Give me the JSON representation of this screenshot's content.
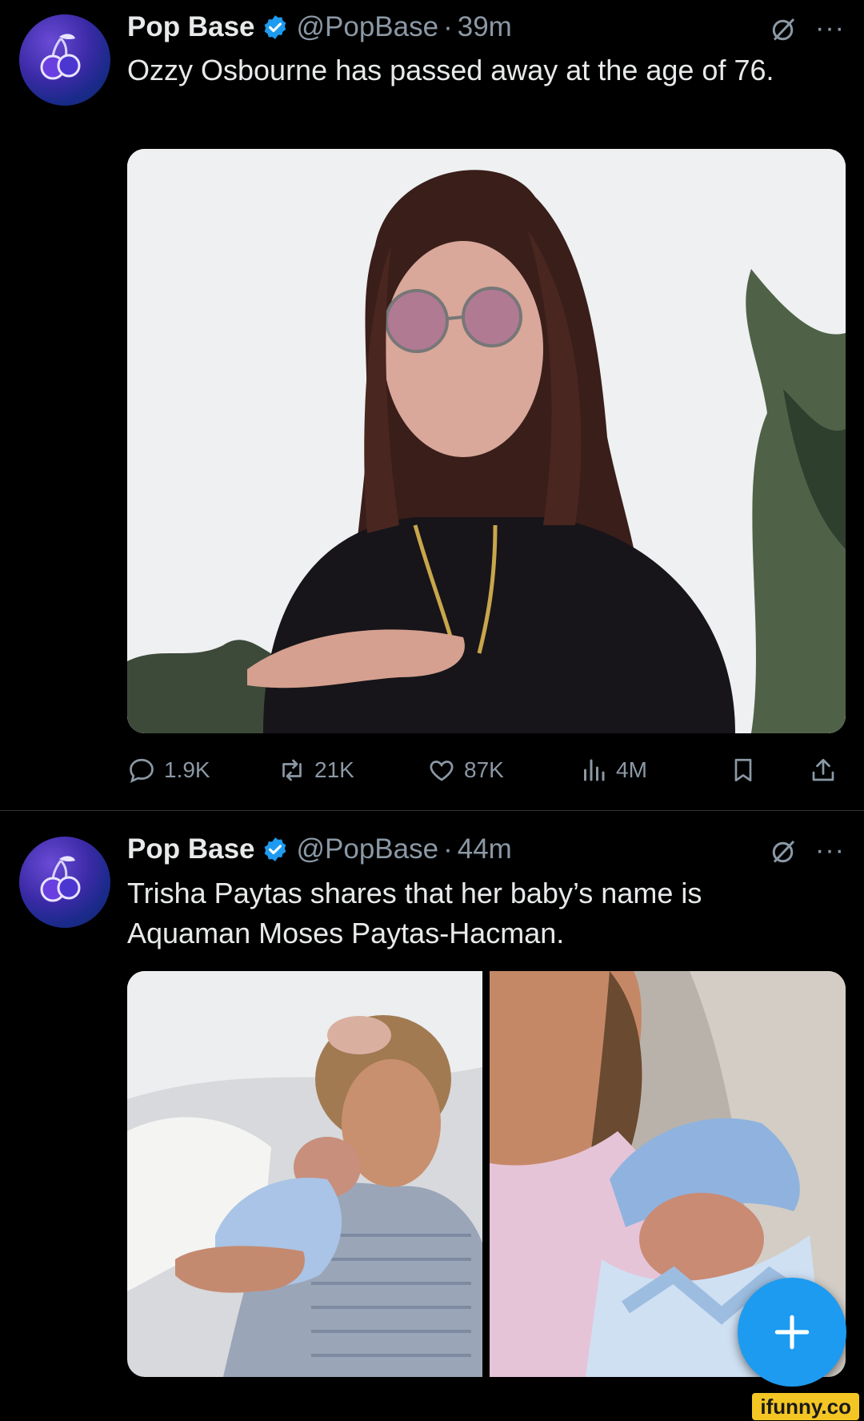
{
  "tweets": [
    {
      "name": "Pop Base",
      "handle": "@PopBase",
      "separator": "·",
      "time": "39m",
      "text": "Ozzy Osbourne has passed away at the age  of 76.",
      "media_alt": "Portrait of Ozzy Osbourne with long dark hair and round tinted glasses",
      "counts": {
        "replies": "1.9K",
        "reposts": "21K",
        "likes": "87K",
        "views": "4M"
      }
    },
    {
      "name": "Pop Base",
      "handle": "@PopBase",
      "separator": "·",
      "time": "44m",
      "text": "Trisha Paytas shares that her baby’s name is Aquaman Moses Paytas-Hacman.",
      "media_alt_left": "Woman lying in hospital bed holding newborn",
      "media_alt_right": "Selfie of woman with newborn wrapped in blue blanket"
    }
  ],
  "more_label": "···",
  "watermark": "ifunny.co",
  "colors": {
    "accent": "#1d9bf0",
    "text": "#e7e9ea",
    "muted": "#8b98a5",
    "bg": "#000000"
  }
}
